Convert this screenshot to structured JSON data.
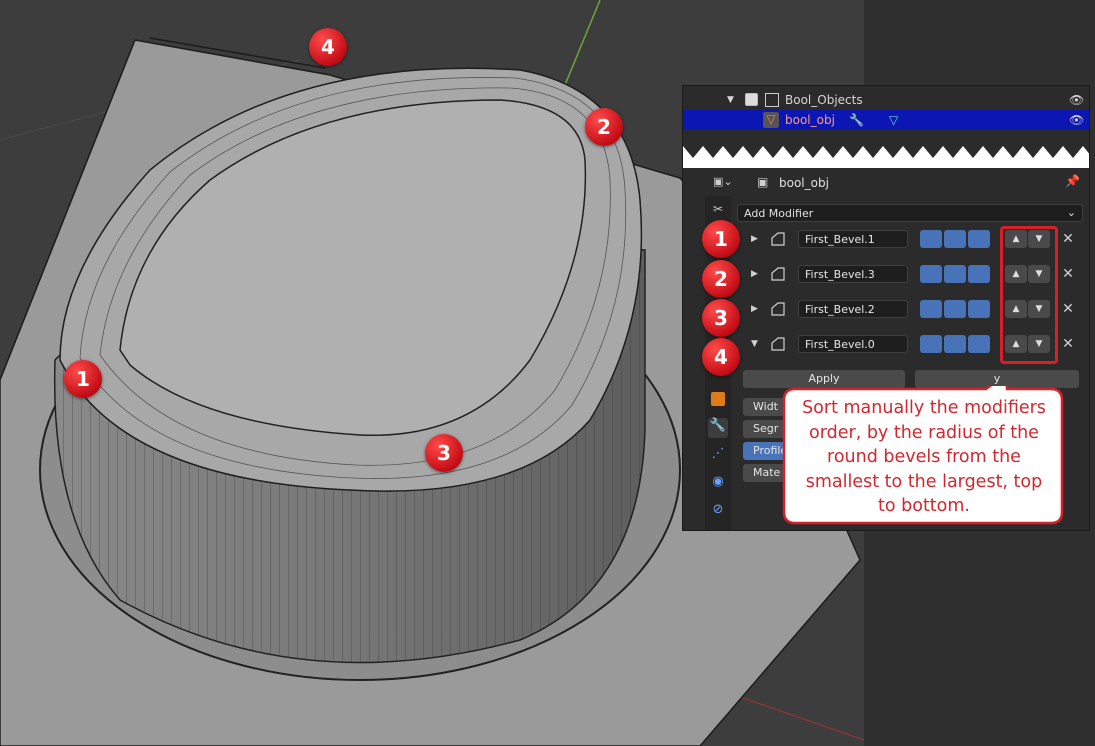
{
  "outliner": {
    "collection_label": "Bool_Objects",
    "object_label": "bool_obj"
  },
  "properties": {
    "object_name": "bool_obj",
    "add_modifier_label": "Add Modifier",
    "modifiers": [
      {
        "name": "First_Bevel.1",
        "expanded": false
      },
      {
        "name": "First_Bevel.3",
        "expanded": false
      },
      {
        "name": "First_Bevel.2",
        "expanded": false
      },
      {
        "name": "First_Bevel.0",
        "expanded": true
      }
    ],
    "apply_label": "Apply",
    "copy_label_visible": "y",
    "sub_labels": [
      "Widt",
      "Segr",
      "Profile",
      "Mate"
    ]
  },
  "annotations": {
    "badges_panel": [
      "1",
      "2",
      "3",
      "4"
    ],
    "badges_viewport": [
      "1",
      "2",
      "3",
      "4"
    ],
    "callout_text": "Sort manually the modifiers order, by the radius of the round bevels from the smallest to the largest, top to bottom.",
    "accent_color": "#d8202a"
  },
  "colors": {
    "selection_blue": "#0c17b3",
    "toggle_blue": "#4873b8",
    "panel_bg": "#2b2b2b"
  }
}
